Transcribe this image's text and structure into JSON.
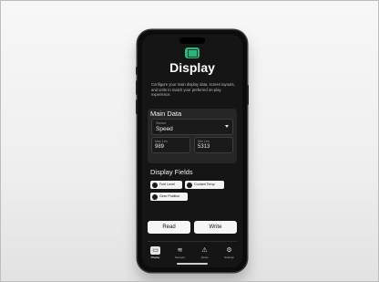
{
  "header": {
    "title": "Display",
    "description": "Configure your main display data, screen layouts, and units to match your preferred on-play experience."
  },
  "main_data": {
    "section_title": "Main Data",
    "select": {
      "label": "Sensor",
      "value": "Speed"
    },
    "fields": [
      {
        "label": "Max Lim",
        "value": "989"
      },
      {
        "label": "Min Lim",
        "value": "5313"
      }
    ]
  },
  "display_fields": {
    "section_title": "Display Fields",
    "chips": [
      {
        "label": "Fuel Level",
        "icon": "fuel-icon"
      },
      {
        "label": "Coolant Temp",
        "icon": "thermometer-icon"
      },
      {
        "label": "Gear Position",
        "icon": "gear-position-icon"
      }
    ]
  },
  "actions": {
    "read_label": "Read",
    "write_label": "Write"
  },
  "nav": {
    "items": [
      {
        "label": "Display",
        "icon": "display-icon",
        "glyph": "▭"
      },
      {
        "label": "Sensors",
        "icon": "sensor-icon",
        "glyph": "≋"
      },
      {
        "label": "Alerts",
        "icon": "alert-icon",
        "glyph": "⚠"
      },
      {
        "label": "Settings",
        "icon": "settings-icon",
        "glyph": "⚙"
      }
    ],
    "active_index": 0
  },
  "colors": {
    "accent": "#2fb37c",
    "screen_bg": "#151515",
    "card_bg": "#262626"
  }
}
